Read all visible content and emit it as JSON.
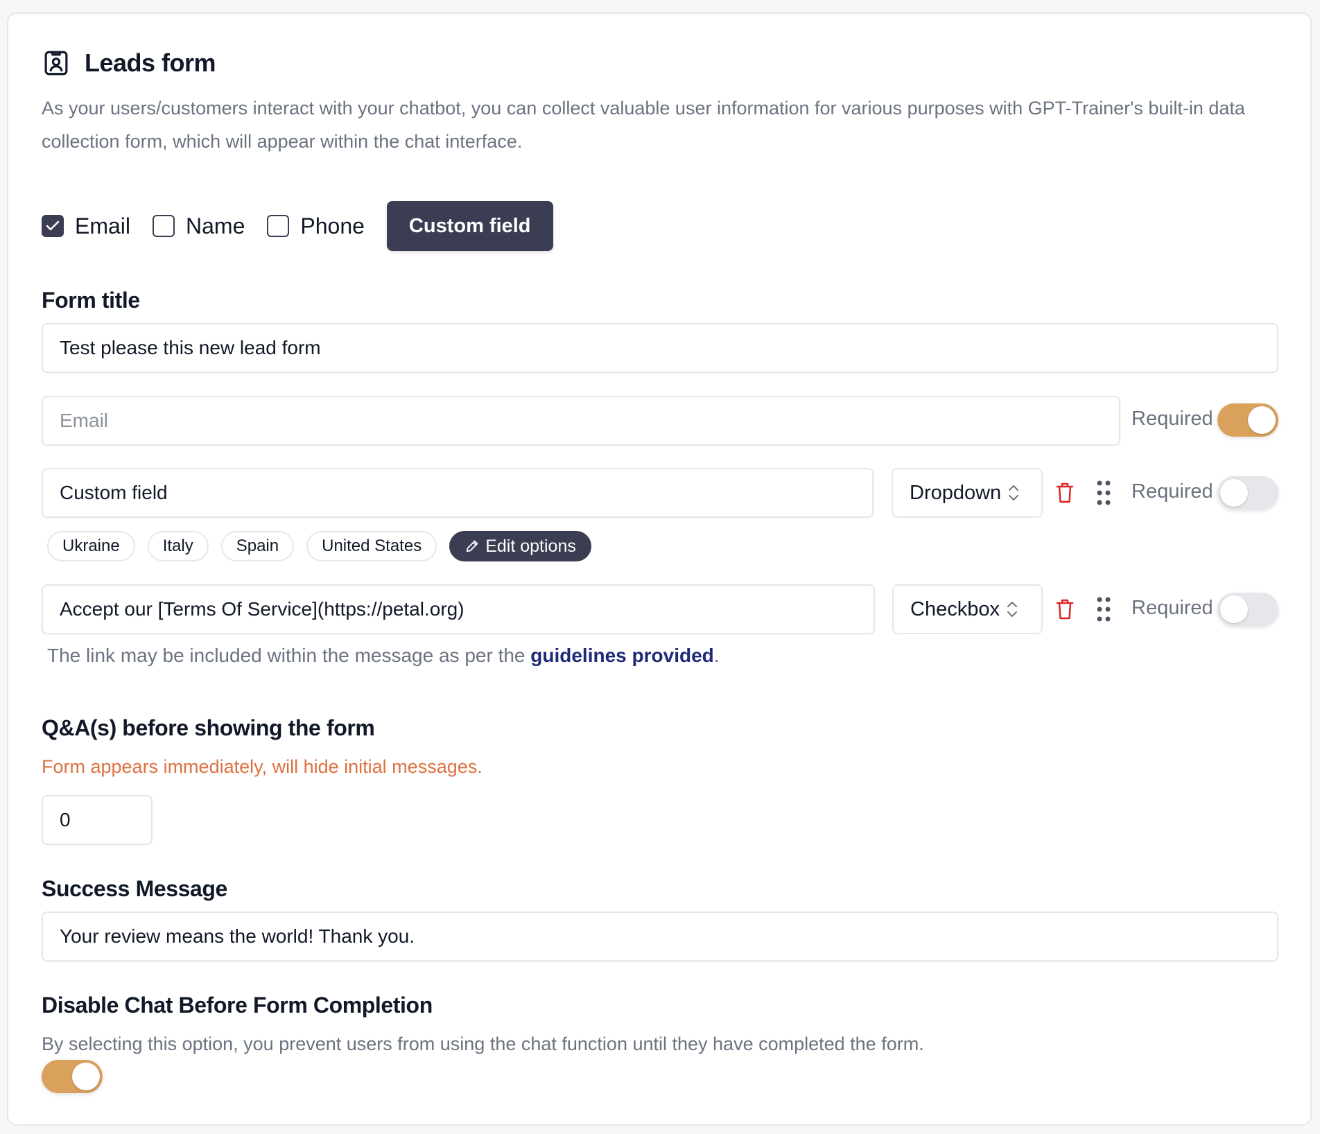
{
  "header": {
    "title": "Leads form",
    "description": "As your users/customers interact with your chatbot, you can collect valuable user information for various purposes with GPT-Trainer's built-in data collection form, which will appear within the chat interface."
  },
  "field_checkboxes": [
    {
      "label": "Email",
      "checked": true
    },
    {
      "label": "Name",
      "checked": false
    },
    {
      "label": "Phone",
      "checked": false
    }
  ],
  "custom_field_button": "Custom field",
  "form_title": {
    "label": "Form title",
    "value": "Test please this new lead form"
  },
  "email_field": {
    "placeholder": "Email",
    "required_label": "Required",
    "required": true
  },
  "custom_field_row": {
    "value": "Custom field",
    "type": "Dropdown",
    "required_label": "Required",
    "required": false,
    "options": [
      "Ukraine",
      "Italy",
      "Spain",
      "United States"
    ],
    "edit_options_label": "Edit options"
  },
  "checkbox_field_row": {
    "value": "Accept our [Terms Of Service](https://petal.org)",
    "type": "Checkbox",
    "required_label": "Required",
    "required": false
  },
  "link_hint": {
    "prefix": "The link may be included within the message as per the ",
    "link_text": "guidelines provided",
    "suffix": "."
  },
  "qa_section": {
    "label": "Q&A(s) before showing the form",
    "warning": "Form appears immediately, will hide initial messages.",
    "value": "0"
  },
  "success_message": {
    "label": "Success Message",
    "value": "Your review means the world! Thank you."
  },
  "disable_chat": {
    "label": "Disable Chat Before Form Completion",
    "description": "By selecting this option, you prevent users from using the chat function until they have completed the form.",
    "enabled": true
  },
  "colors": {
    "accent_dark": "#3b3d52",
    "toggle_on": "#daa15c",
    "danger": "#dc2626",
    "warning_text": "#e07040",
    "link": "#1e2a78"
  },
  "icons": {
    "header": "user-badge-icon",
    "delete": "trash-icon",
    "drag": "drag-handle-icon",
    "select": "chevron-up-down-icon",
    "edit": "pencil-icon",
    "check": "checkmark-icon"
  }
}
